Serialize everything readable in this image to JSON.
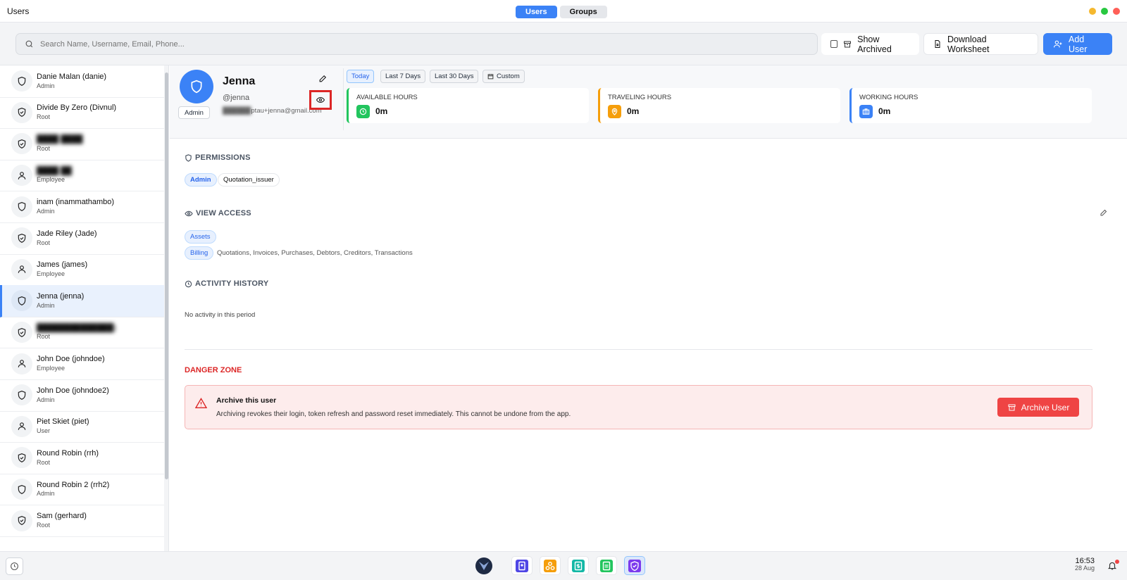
{
  "window": {
    "title": "Users",
    "tabs": [
      {
        "label": "Users"
      },
      {
        "label": "Groups"
      }
    ]
  },
  "colors": {
    "accent": "#3b82f6",
    "danger": "#ef4444",
    "available": "#22c55e",
    "traveling": "#f59e0b",
    "working": "#3b82f6"
  },
  "toolbar": {
    "search_placeholder": "Search Name, Username, Email, Phone...",
    "show_archived": "Show Archived",
    "download": "Download Worksheet",
    "add_user": "Add User"
  },
  "users": [
    {
      "name": "Danie Malan (danie)",
      "role": "Admin",
      "icon": "shield-icon"
    },
    {
      "name": "Divide By Zero (Divnul)",
      "role": "Root",
      "icon": "shield-check-icon"
    },
    {
      "name": "████ ████",
      "role": "Root",
      "icon": "shield-check-icon",
      "blurred": true
    },
    {
      "name": "████ ██",
      "role": "Employee",
      "icon": "person-icon",
      "blurred": true
    },
    {
      "name": "inam (inammathambo)",
      "role": "Admin",
      "icon": "shield-icon"
    },
    {
      "name": "Jade Riley (Jade)",
      "role": "Root",
      "icon": "shield-check-icon"
    },
    {
      "name": "James (james)",
      "role": "Employee",
      "icon": "person-icon"
    },
    {
      "name": "Jenna (jenna)",
      "role": "Admin",
      "icon": "shield-icon",
      "selected": true
    },
    {
      "name": "██████████████)",
      "role": "Root",
      "icon": "shield-check-icon",
      "blurred": true
    },
    {
      "name": "John Doe (johndoe)",
      "role": "Employee",
      "icon": "person-icon"
    },
    {
      "name": "John Doe (johndoe2)",
      "role": "Admin",
      "icon": "shield-icon"
    },
    {
      "name": "Piet Skiet (piet)",
      "role": "User",
      "icon": "person-icon"
    },
    {
      "name": "Round Robin (rrh)",
      "role": "Root",
      "icon": "shield-check-icon"
    },
    {
      "name": "Round Robin 2 (rrh2)",
      "role": "Admin",
      "icon": "shield-icon"
    },
    {
      "name": "Sam (gerhard)",
      "role": "Root",
      "icon": "shield-check-icon"
    }
  ],
  "profile": {
    "name": "Jenna",
    "username": "@jenna",
    "email_hidden": "██████",
    "email_visible": "ptau+jenna@gmail.com",
    "role": "Admin"
  },
  "ranges": [
    "Today",
    "Last 7 Days",
    "Last 30 Days",
    "Custom"
  ],
  "stats": [
    {
      "label": "AVAILABLE HOURS",
      "value": "0m",
      "icon": "clock-icon"
    },
    {
      "label": "TRAVELING HOURS",
      "value": "0m",
      "icon": "map-pin-icon"
    },
    {
      "label": "WORKING HOURS",
      "value": "0m",
      "icon": "briefcase-icon"
    }
  ],
  "permissions": {
    "title": "PERMISSIONS",
    "tags": [
      "Admin",
      "Quotation_issuer"
    ]
  },
  "view_access": {
    "title": "VIEW ACCESS",
    "assets": "Assets",
    "billing": "Billing",
    "billing_items": "Quotations, Invoices, Purchases, Debtors, Creditors, Transactions"
  },
  "activity": {
    "title": "ACTIVITY HISTORY",
    "empty": "No activity in this period"
  },
  "danger": {
    "title": "DANGER ZONE",
    "heading": "Archive this user",
    "description": "Archiving revokes their login, token refresh and password reset immediately. This cannot be undone from the app.",
    "button": "Archive User"
  },
  "taskbar": {
    "time": "16:53",
    "date": "28 Aug"
  }
}
